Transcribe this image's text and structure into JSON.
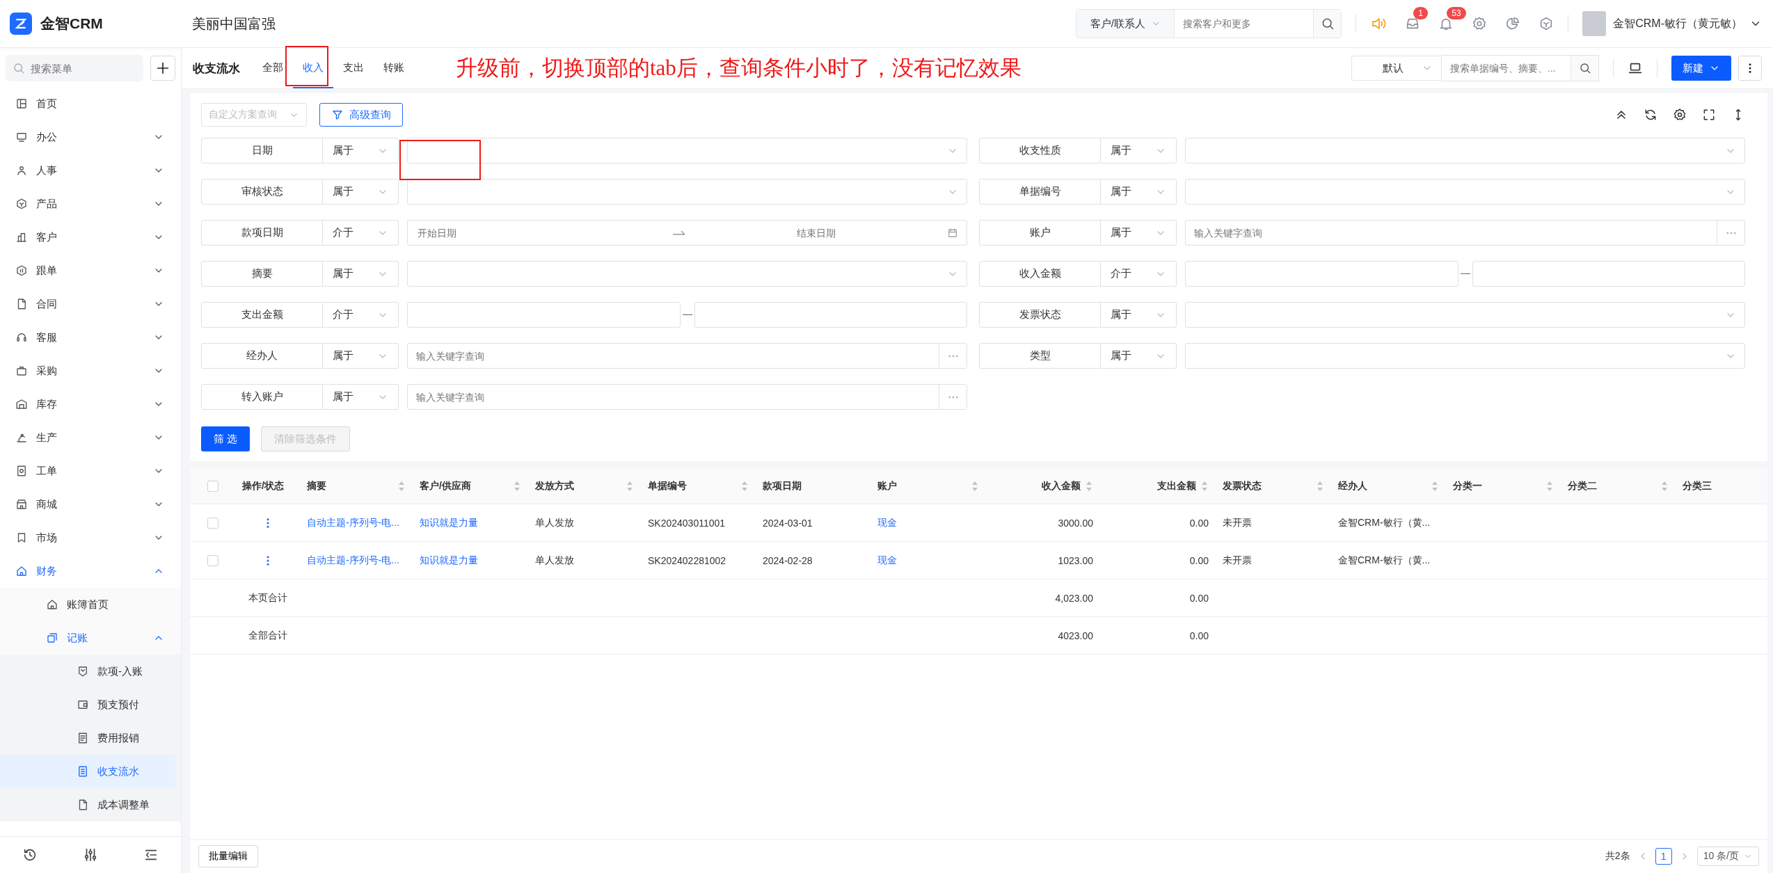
{
  "header": {
    "brand": "金智CRM",
    "company": "美丽中国富强",
    "search": {
      "scope": "客户/联系人",
      "placeholder": "搜索客户和更多"
    },
    "inbox_badge": "1",
    "bell_badge": "53",
    "user": "金智CRM-敏行（黄元敏）"
  },
  "sidebar": {
    "search_placeholder": "搜索菜单",
    "items": [
      {
        "label": "首页",
        "selected": false
      },
      {
        "label": "办公",
        "selected": false,
        "expanded": false
      },
      {
        "label": "人事",
        "selected": false,
        "expanded": false
      },
      {
        "label": "产品",
        "selected": false,
        "expanded": false
      },
      {
        "label": "客户",
        "selected": false,
        "expanded": false
      },
      {
        "label": "跟单",
        "selected": false,
        "expanded": false
      },
      {
        "label": "合同",
        "selected": false,
        "expanded": false
      },
      {
        "label": "客服",
        "selected": false,
        "expanded": false
      },
      {
        "label": "采购",
        "selected": false,
        "expanded": false
      },
      {
        "label": "库存",
        "selected": false,
        "expanded": false
      },
      {
        "label": "生产",
        "selected": false,
        "expanded": false
      },
      {
        "label": "工单",
        "selected": false,
        "expanded": false
      },
      {
        "label": "商城",
        "selected": false,
        "expanded": false
      },
      {
        "label": "市场",
        "selected": false,
        "expanded": false
      },
      {
        "label": "财务",
        "selected": false,
        "expanded": true,
        "children": [
          {
            "label": "账簿首页",
            "selected": false
          },
          {
            "label": "记账",
            "selected": false,
            "expanded": true,
            "children": [
              {
                "label": "款项-入账",
                "selected": false
              },
              {
                "label": "预支预付",
                "selected": false
              },
              {
                "label": "费用报销",
                "selected": false
              },
              {
                "label": "收支流水",
                "selected": true
              },
              {
                "label": "成本调整单",
                "selected": false
              }
            ]
          }
        ]
      }
    ]
  },
  "page": {
    "title": "收支流水",
    "tabs": [
      {
        "label": "全部",
        "selected": false
      },
      {
        "label": "收入",
        "selected": true
      },
      {
        "label": "支出",
        "selected": false
      },
      {
        "label": "转账",
        "selected": false
      }
    ],
    "annotation": "升级前，切换顶部的tab后，查询条件小时了，没有记忆效果",
    "view_select": "默认",
    "search_placeholder": "搜索单据编号、摘要、...",
    "new_button": "新建"
  },
  "filter": {
    "scheme_placeholder": "自定义方案查询",
    "advanced_button": "高级查询",
    "conditions": [
      {
        "label": "日期",
        "operator": "属于",
        "kind": "select"
      },
      {
        "label": "收支性质",
        "operator": "属于",
        "kind": "select"
      },
      {
        "label": "审核状态",
        "operator": "属于",
        "kind": "select"
      },
      {
        "label": "单据编号",
        "operator": "属于",
        "kind": "select"
      },
      {
        "label": "款项日期",
        "operator": "介于",
        "kind": "date_range",
        "start_placeholder": "开始日期",
        "end_placeholder": "结束日期"
      },
      {
        "label": "账户",
        "operator": "属于",
        "kind": "lookup",
        "placeholder": "输入关键字查询"
      },
      {
        "label": "摘要",
        "operator": "属于",
        "kind": "select"
      },
      {
        "label": "收入金额",
        "operator": "介于",
        "kind": "number_range"
      },
      {
        "label": "支出金额",
        "operator": "介于",
        "kind": "number_range"
      },
      {
        "label": "发票状态",
        "operator": "属于",
        "kind": "select"
      },
      {
        "label": "经办人",
        "operator": "属于",
        "kind": "lookup",
        "placeholder": "输入关键字查询"
      },
      {
        "label": "类型",
        "operator": "属于",
        "kind": "select"
      },
      {
        "label": "转入账户",
        "operator": "属于",
        "kind": "lookup",
        "placeholder": "输入关键字查询"
      }
    ],
    "apply_button": "筛 选",
    "clear_button": {
      "label": "清除筛选条件",
      "disabled": true
    }
  },
  "table": {
    "all_checked": false,
    "columns": [
      {
        "label": "操作/状态",
        "sortable": false,
        "kind": "text"
      },
      {
        "label": "摘要",
        "sortable": true,
        "kind": "text"
      },
      {
        "label": "客户/供应商",
        "sortable": true,
        "kind": "text"
      },
      {
        "label": "发放方式",
        "sortable": true,
        "kind": "text"
      },
      {
        "label": "单据编号",
        "sortable": true,
        "kind": "text"
      },
      {
        "label": "款项日期",
        "sortable": false,
        "kind": "text"
      },
      {
        "label": "账户",
        "sortable": true,
        "kind": "text"
      },
      {
        "label": "收入金额",
        "sortable": true,
        "kind": "amount"
      },
      {
        "label": "支出金额",
        "sortable": true,
        "kind": "amount"
      },
      {
        "label": "发票状态",
        "sortable": true,
        "kind": "text"
      },
      {
        "label": "经办人",
        "sortable": true,
        "kind": "text"
      },
      {
        "label": "分类一",
        "sortable": true,
        "kind": "text"
      },
      {
        "label": "分类二",
        "sortable": true,
        "kind": "text"
      },
      {
        "label": "分类三",
        "sortable": false,
        "kind": "text"
      }
    ],
    "rows": [
      {
        "checked": false,
        "cells": [
          {
            "kind": "actions"
          },
          {
            "text": "自动主题-序列号-电...",
            "kind": "link"
          },
          {
            "text": "知识就是力量",
            "kind": "link"
          },
          {
            "text": "单人发放",
            "kind": "text"
          },
          {
            "text": "SK202403011001",
            "kind": "text"
          },
          {
            "text": "2024-03-01",
            "kind": "text"
          },
          {
            "text": "现金",
            "kind": "link"
          },
          {
            "text": "3000.00",
            "kind": "text"
          },
          {
            "text": "0.00",
            "kind": "text"
          },
          {
            "text": "未开票",
            "kind": "text"
          },
          {
            "text": "金智CRM-敏行（黄...",
            "kind": "text"
          }
        ]
      },
      {
        "checked": false,
        "cells": [
          {
            "kind": "actions"
          },
          {
            "text": "自动主题-序列号-电...",
            "kind": "link"
          },
          {
            "text": "知识就是力量",
            "kind": "link"
          },
          {
            "text": "单人发放",
            "kind": "text"
          },
          {
            "text": "SK202402281002",
            "kind": "text"
          },
          {
            "text": "2024-02-28",
            "kind": "text"
          },
          {
            "text": "现金",
            "kind": "link"
          },
          {
            "text": "1023.00",
            "kind": "text"
          },
          {
            "text": "0.00",
            "kind": "text"
          },
          {
            "text": "未开票",
            "kind": "text"
          },
          {
            "text": "金智CRM-敏行（黄...",
            "kind": "text"
          }
        ]
      }
    ],
    "summaries": [
      {
        "label": "本页合计",
        "income": "4,023.00",
        "expense": "0.00"
      },
      {
        "label": "全部合计",
        "income": "4023.00",
        "expense": "0.00"
      }
    ]
  },
  "footer": {
    "batch_button": "批量编辑",
    "total": "共2条",
    "pages": [
      {
        "label": "1",
        "selected": true
      }
    ],
    "page_size": "10 条/页"
  }
}
